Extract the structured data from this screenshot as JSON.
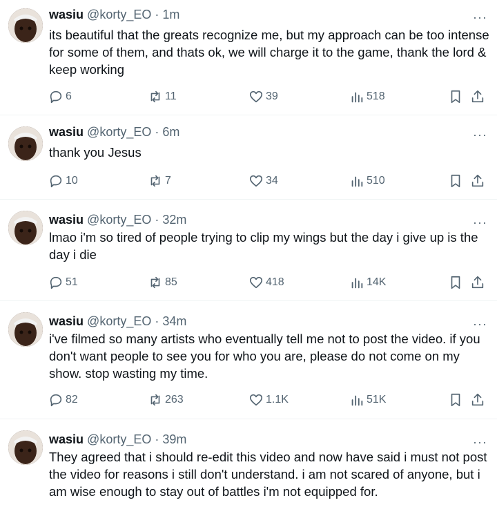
{
  "tweets": [
    {
      "name": "wasiu",
      "handle": "@korty_EO",
      "time": "1m",
      "text": "its beautiful that the greats recognize me, but my approach can be too intense for some of them, and thats ok, we will charge it to the game, thank the lord & keep working",
      "replies": "6",
      "retweets": "11",
      "likes": "39",
      "views": "518"
    },
    {
      "name": "wasiu",
      "handle": "@korty_EO",
      "time": "6m",
      "text": "thank you Jesus",
      "replies": "10",
      "retweets": "7",
      "likes": "34",
      "views": "510"
    },
    {
      "name": "wasiu",
      "handle": "@korty_EO",
      "time": "32m",
      "text": "lmao i'm so tired of people trying to clip my wings but the day i give up is the day i die",
      "replies": "51",
      "retweets": "85",
      "likes": "418",
      "views": "14K"
    },
    {
      "name": "wasiu",
      "handle": "@korty_EO",
      "time": "34m",
      "text": "i've filmed so many artists who eventually tell me not to post the video. if you don't want people to see you for who you are, please do not come on my show. stop wasting my time.",
      "replies": "82",
      "retweets": "263",
      "likes": "1.1K",
      "views": "51K"
    },
    {
      "name": "wasiu",
      "handle": "@korty_EO",
      "time": "39m",
      "text": "They agreed that i should re-edit this video and now have said i must not post the video for reasons i still don't understand. i am not scared of anyone, but i am wise enough to stay out of battles i'm not equipped for."
    }
  ],
  "separator": "·",
  "more_label": "···",
  "icons": [
    "reply-icon",
    "retweet-icon",
    "like-icon",
    "views-icon",
    "bookmark-icon",
    "share-icon"
  ],
  "colors": {
    "text": "#0f1419",
    "muted": "#536471",
    "divider": "#eff3f4"
  }
}
